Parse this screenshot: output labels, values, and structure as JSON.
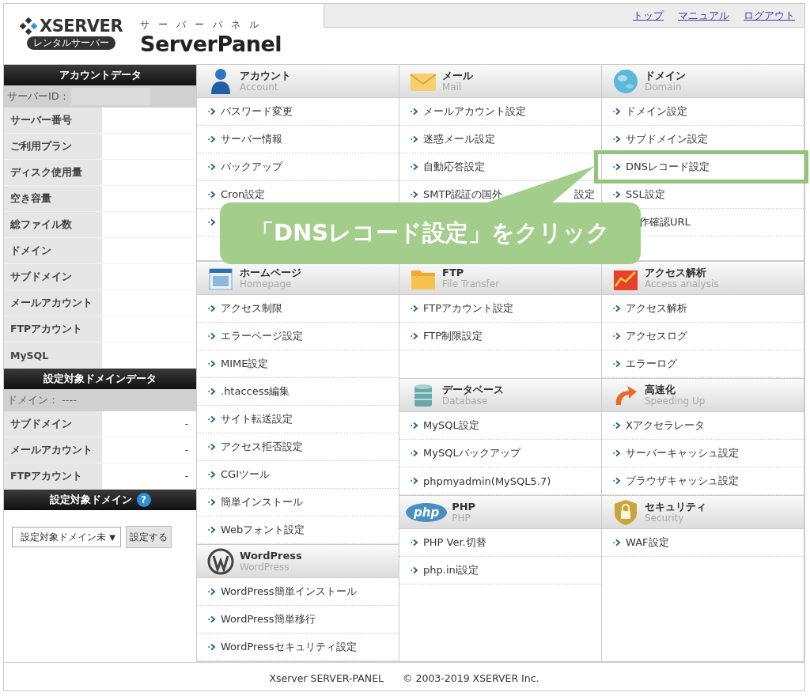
{
  "header": {
    "logo": "XSERVER",
    "logo_badge": "レンタルサーバー",
    "panel_kana": "サーバーパネル",
    "panel_title": "ServerPanel",
    "nav": [
      {
        "label": "トップ"
      },
      {
        "label": "マニュアル"
      },
      {
        "label": "ログアウト"
      }
    ]
  },
  "sidebar": {
    "account_title": "アカウントデータ",
    "server_id_label": "サーバーID：",
    "account_rows": [
      {
        "label": "サーバー番号"
      },
      {
        "label": "ご利用プラン"
      },
      {
        "label": "ディスク使用量"
      },
      {
        "label": "空き容量"
      },
      {
        "label": "総ファイル数"
      },
      {
        "label": "ドメイン"
      },
      {
        "label": "サブドメイン"
      },
      {
        "label": "メールアカウント"
      },
      {
        "label": "FTPアカウント"
      },
      {
        "label": "MySQL"
      }
    ],
    "domain_title": "設定対象ドメインデータ",
    "domain_label": "ドメイン： ----",
    "domain_rows": [
      {
        "label": "サブドメイン",
        "value": "-"
      },
      {
        "label": "メールアカウント",
        "value": "-"
      },
      {
        "label": "FTPアカウント",
        "value": "-"
      }
    ],
    "target_title": "設定対象ドメイン",
    "help": "?",
    "select": {
      "value": "設定対象ドメイン未",
      "arrow": "▼"
    },
    "set_button": "設定する"
  },
  "top_sections": [
    {
      "title": "アカウント",
      "subtitle": "Account",
      "items": [
        {
          "label": "パスワード変更"
        },
        {
          "label": "サーバー情報"
        },
        {
          "label": "バックアップ"
        },
        {
          "label": "Cron設定"
        },
        {
          "kind": "hidden"
        }
      ]
    },
    {
      "title": "メール",
      "subtitle": "Mail",
      "items": [
        {
          "label": "メールアカウント設定"
        },
        {
          "label": "迷惑メール設定"
        },
        {
          "label": "自動応答設定"
        },
        {
          "label": "SMTP認証の国外",
          "label_end": "設定",
          "kind": "split"
        }
      ]
    },
    {
      "title": "ドメイン",
      "subtitle": "Domain",
      "items": [
        {
          "label": "ドメイン設定"
        },
        {
          "label": "サブドメイン設定"
        },
        {
          "label": "DNSレコード設定",
          "highlighted": true
        },
        {
          "label": "SSL設定"
        },
        {
          "label": "作確認URL",
          "kind": "cut"
        }
      ]
    }
  ],
  "left_sections": [
    {
      "title": "ホームページ",
      "subtitle": "Homepage",
      "items": [
        {
          "label": "アクセス制限"
        },
        {
          "label": "エラーページ設定"
        },
        {
          "label": "MIME設定"
        },
        {
          "label": ".htaccess編集"
        },
        {
          "label": "サイト転送設定"
        },
        {
          "label": "アクセス拒否設定"
        },
        {
          "label": "CGIツール"
        },
        {
          "label": "簡単インストール"
        },
        {
          "label": "Webフォント設定"
        }
      ]
    },
    {
      "title": "WordPress",
      "subtitle": "WordPress",
      "items": [
        {
          "label": "WordPress簡単インストール"
        },
        {
          "label": "WordPress簡単移行"
        },
        {
          "label": "WordPressセキュリティ設定"
        }
      ]
    }
  ],
  "paired_sections": [
    {
      "title": "FTP",
      "subtitle": "File Transfer",
      "items": [
        {
          "label": "FTPアカウント設定"
        },
        {
          "label": "FTP制限設定"
        }
      ]
    },
    {
      "title": "アクセス解析",
      "subtitle": "Access analysis",
      "items": [
        {
          "label": "アクセス解析"
        },
        {
          "label": "アクセスログ"
        },
        {
          "label": "エラーログ"
        }
      ]
    },
    {
      "title": "データベース",
      "subtitle": "Database",
      "items": [
        {
          "label": "MySQL設定"
        },
        {
          "label": "MySQLバックアップ"
        },
        {
          "label": "phpmyadmin(MySQL5.7)"
        }
      ]
    },
    {
      "title": "高速化",
      "subtitle": "Speeding Up",
      "items": [
        {
          "label": "Xアクセラレータ"
        },
        {
          "label": "サーバーキャッシュ設定"
        },
        {
          "label": "ブラウザキャッシュ設定"
        }
      ]
    },
    {
      "title": "PHP",
      "subtitle": "PHP",
      "logo_text": "php",
      "items": [
        {
          "label": "PHP Ver.切替"
        },
        {
          "label": "php.ini設定"
        }
      ]
    },
    {
      "title": "セキュリティ",
      "subtitle": "Security",
      "items": [
        {
          "label": "WAF設定"
        }
      ]
    }
  ],
  "callout": "「DNSレコード設定」をクリック",
  "footer": {
    "product": "Xserver SERVER-PANEL",
    "copyright": "© 2003-2019 XSERVER Inc."
  }
}
